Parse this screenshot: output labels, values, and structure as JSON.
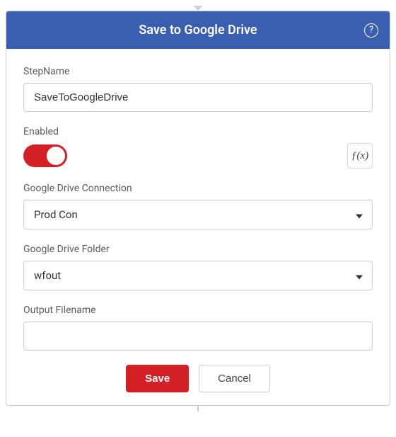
{
  "header": {
    "title": "Save to Google Drive"
  },
  "fields": {
    "stepName": {
      "label": "StepName",
      "value": "SaveToGoogleDrive"
    },
    "enabled": {
      "label": "Enabled",
      "fx_label": "ƒ(x)"
    },
    "connection": {
      "label": "Google Drive Connection",
      "value": "Prod Con"
    },
    "folder": {
      "label": "Google Drive Folder",
      "value": "wfout"
    },
    "outputFilename": {
      "label": "Output Filename",
      "value": ""
    }
  },
  "buttons": {
    "save": "Save",
    "cancel": "Cancel"
  }
}
